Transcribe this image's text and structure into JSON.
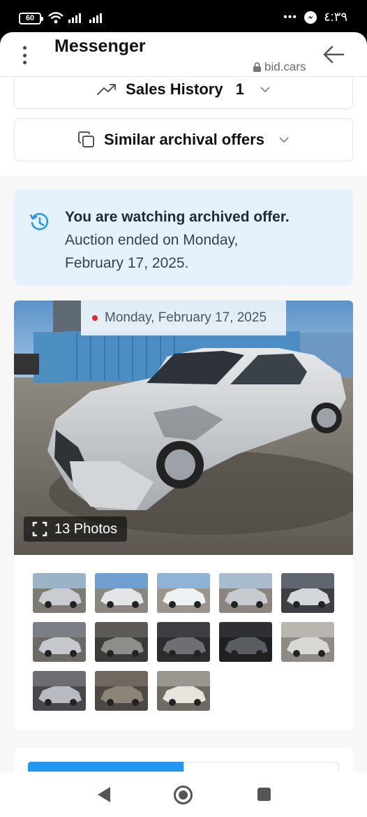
{
  "status_bar": {
    "battery": "60",
    "time": "٤:٣٩",
    "overflow": "•••"
  },
  "header": {
    "title": "Messenger",
    "domain": "bid.cars"
  },
  "accordions": {
    "sales_history": {
      "label": "Sales History",
      "count": "1"
    },
    "similar_offers": {
      "label": "Similar archival offers"
    }
  },
  "notice": {
    "title": "You are watching archived offer.",
    "line1": "Auction ended on Monday,",
    "line2": "February 17, 2025."
  },
  "gallery": {
    "date": "Monday, February 17, 2025",
    "photo_count": "13 Photos",
    "thumb_count": 13
  },
  "colors": {
    "accent": "#2196f3",
    "notice_bg": "#e5f1fc",
    "date_dot": "#dc2626"
  },
  "icons": {
    "header_back": "arrow-left-icon",
    "header_menu": "kebab-menu-icon",
    "sales_history": "trending-up-icon",
    "similar": "copy-icon",
    "notice": "history-icon",
    "fullscreen": "fullscreen-icon"
  }
}
